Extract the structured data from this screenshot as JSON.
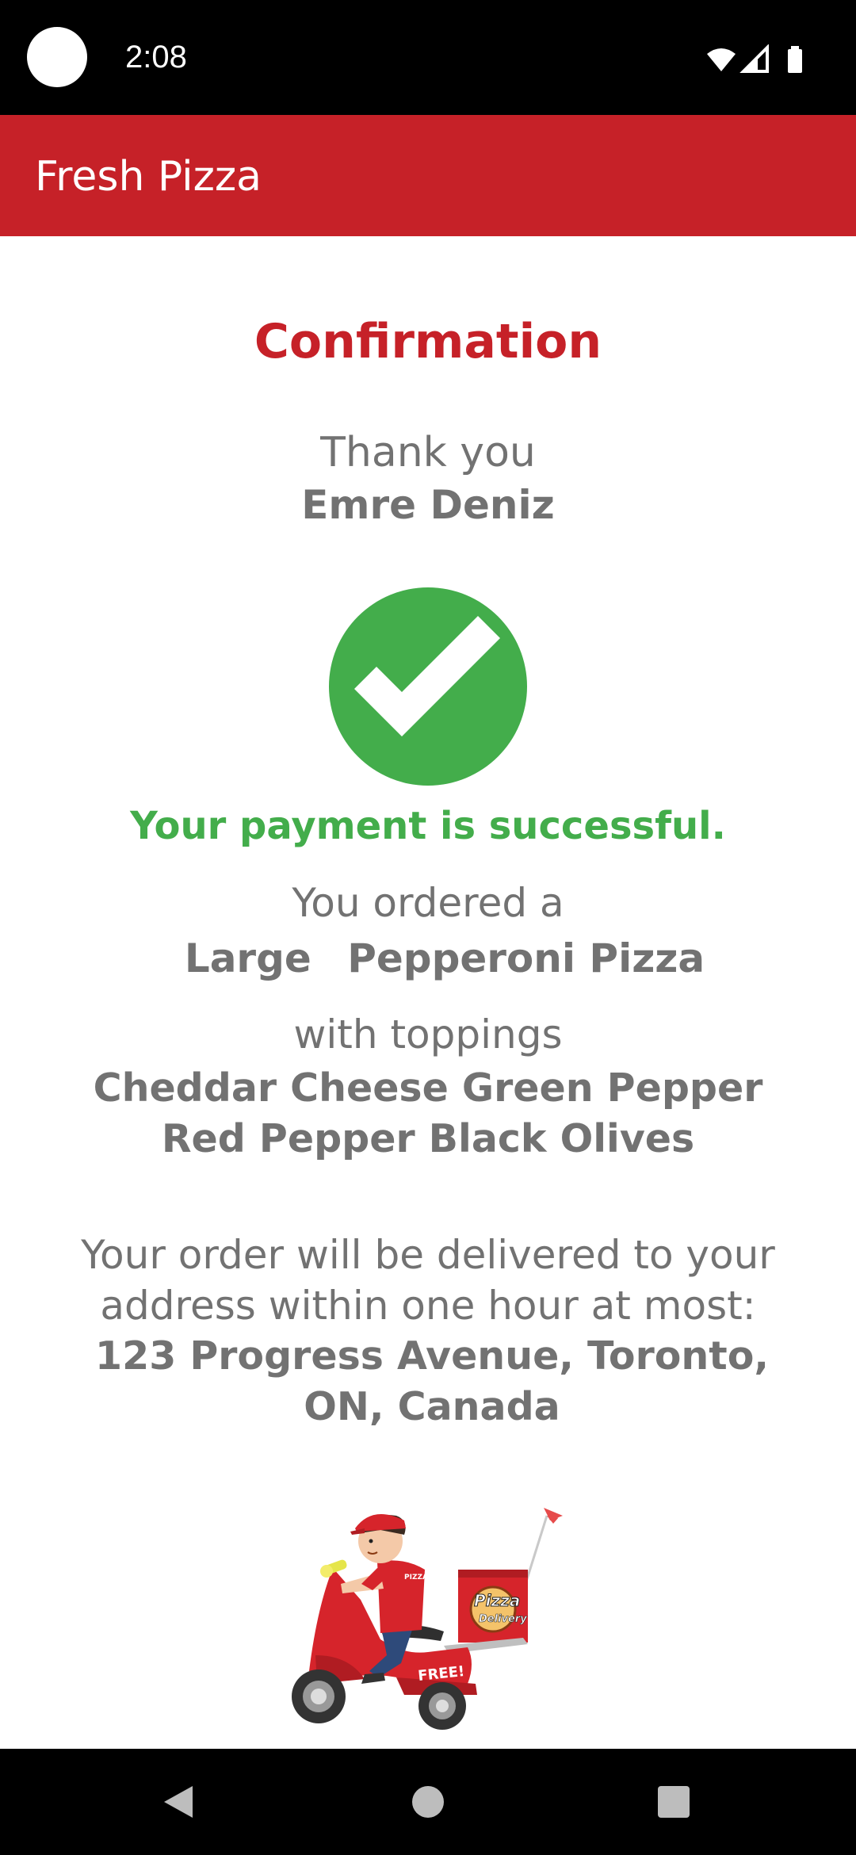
{
  "status_bar": {
    "time": "2:08"
  },
  "app_bar": {
    "title": "Fresh Pizza"
  },
  "confirmation": {
    "heading": "Confirmation",
    "thank_you": "Thank you",
    "customer_name": "Emre Deniz",
    "payment_message": "Your payment is successful.",
    "ordered_label": "You ordered a",
    "pizza_size": "Large",
    "pizza_type": "Pepperoni Pizza",
    "toppings_label": "with toppings",
    "toppings": "Cheddar Cheese Green Pepper Red Pepper Black Olives",
    "delivery_message": "Your order will be delivered to your address within one hour at most:",
    "address": "123 Progress Avenue, Toronto, ON, Canada"
  },
  "illustration": {
    "box_text_1": "Pizza",
    "box_text_2": "Delivery",
    "scooter_text": "FREE!",
    "shirt_text": "PIZZA"
  },
  "colors": {
    "brand_red": "#c62128",
    "success_green": "#43ad4b",
    "text_grey": "#727272"
  },
  "icons": {
    "success": "check-circle-icon",
    "wifi": "wifi-icon",
    "signal": "signal-icon",
    "battery": "battery-icon",
    "back": "back-triangle-icon",
    "home": "home-circle-icon",
    "recents": "recents-square-icon"
  }
}
